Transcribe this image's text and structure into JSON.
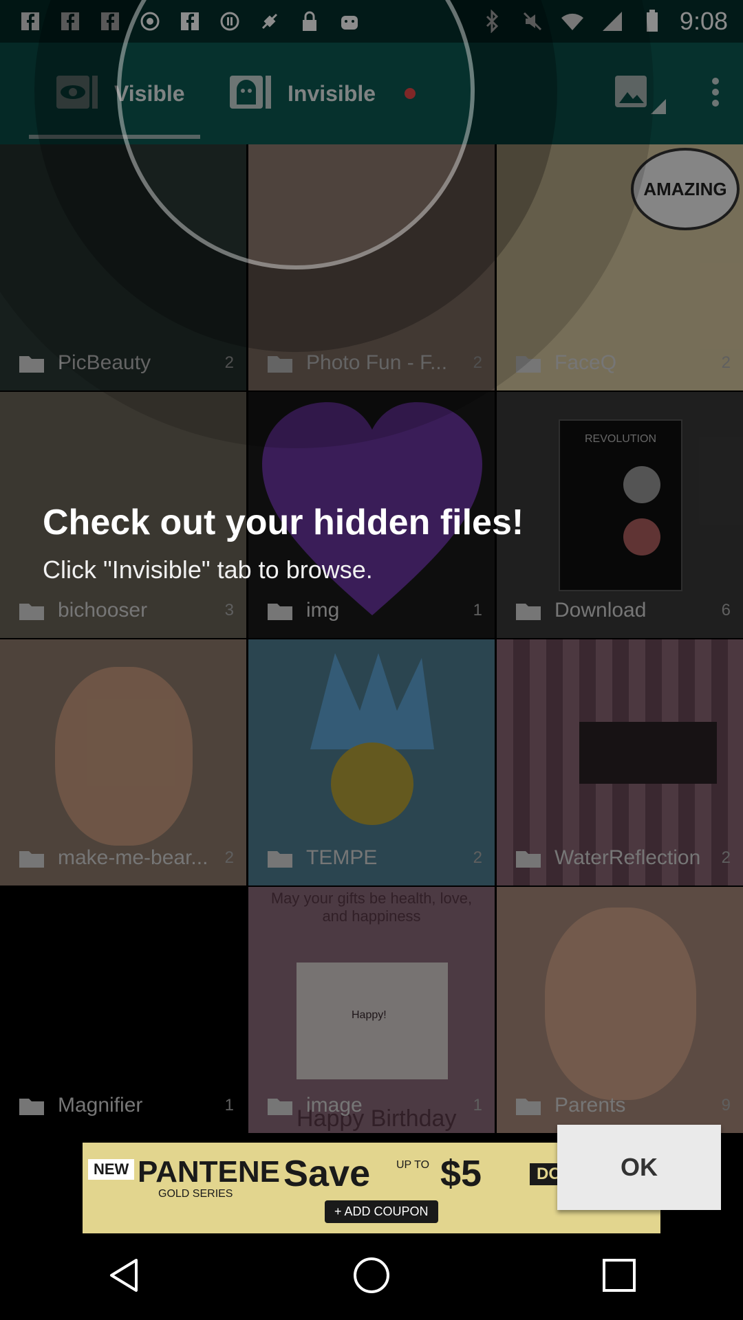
{
  "status_bar": {
    "time": "9:08",
    "left_icons": [
      "facebook-icon",
      "facebook-icon",
      "facebook-icon",
      "radio-icon",
      "facebook-icon",
      "pause-circle-icon",
      "no-satellite-icon",
      "lock-icon",
      "android-icon"
    ],
    "right_icons": [
      "bluetooth-icon",
      "mute-icon",
      "wifi-icon",
      "signal-icon",
      "battery-icon"
    ]
  },
  "app_bar": {
    "tab_visible_label": "Visible",
    "tab_invisible_label": "Invisible",
    "actions": [
      "image-icon",
      "more-icon"
    ]
  },
  "folders": [
    {
      "name": "PicBeauty",
      "count": "2",
      "bg": "#2a3a36"
    },
    {
      "name": "Photo Fun - F...",
      "count": "2",
      "bg": "#8f7b70"
    },
    {
      "name": "FaceQ",
      "count": "2",
      "bg": "#d8c8a0"
    },
    {
      "name": "bichooser",
      "count": "3",
      "bg": "#6b6458"
    },
    {
      "name": "img",
      "count": "1",
      "bg": "#5a2d83"
    },
    {
      "name": "Download",
      "count": "6",
      "bg": "#3a3a3a"
    },
    {
      "name": "make-me-bear...",
      "count": "2",
      "bg": "#8e7b6c"
    },
    {
      "name": "TEMPE",
      "count": "2",
      "bg": "#4f7f93"
    },
    {
      "name": "WaterReflection",
      "count": "2",
      "bg": "#7a5d68"
    },
    {
      "name": "Magnifier",
      "count": "1",
      "bg": "#000000"
    },
    {
      "name": "image",
      "count": "1",
      "bg": "#8a6a7a"
    },
    {
      "name": "Parents",
      "count": "9",
      "bg": "#a8897a"
    }
  ],
  "tile_texts": {
    "amazing": "AMAZING",
    "revolution": "REVOLUTION",
    "gift_top": "May your gifts be health, love, and happiness",
    "gift_mid": "Happy!",
    "gift_bottom": "Happy Birthday"
  },
  "tutorial": {
    "title": "Check out your hidden files!",
    "subtitle": "Click \"Invisible\" tab to browse."
  },
  "ad": {
    "new": "NEW",
    "brand": "PANTENE",
    "brand_sub": "GOLD SERIES",
    "save": "Save",
    "up_to": "UP TO",
    "amount": "$5",
    "store": "DOLLAR",
    "coupon": "+ ADD COUPON"
  },
  "ok_label": "OK",
  "nav": [
    "back-icon",
    "home-icon",
    "recents-icon"
  ]
}
